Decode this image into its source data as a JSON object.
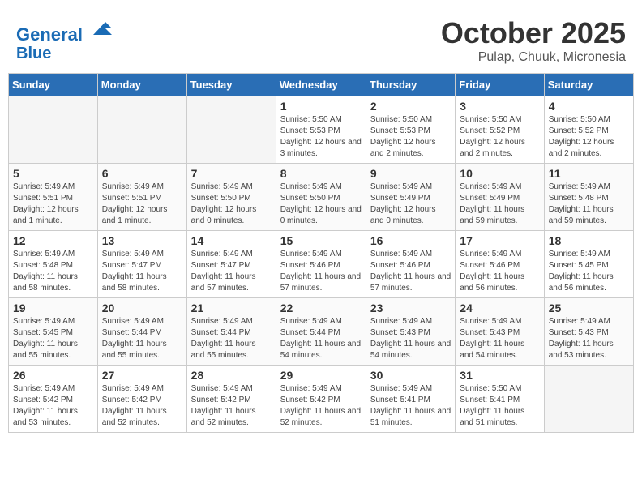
{
  "header": {
    "logo_line1": "General",
    "logo_line2": "Blue",
    "month": "October 2025",
    "location": "Pulap, Chuuk, Micronesia"
  },
  "days_of_week": [
    "Sunday",
    "Monday",
    "Tuesday",
    "Wednesday",
    "Thursday",
    "Friday",
    "Saturday"
  ],
  "weeks": [
    [
      {
        "num": "",
        "info": ""
      },
      {
        "num": "",
        "info": ""
      },
      {
        "num": "",
        "info": ""
      },
      {
        "num": "1",
        "info": "Sunrise: 5:50 AM\nSunset: 5:53 PM\nDaylight: 12 hours and 3 minutes."
      },
      {
        "num": "2",
        "info": "Sunrise: 5:50 AM\nSunset: 5:53 PM\nDaylight: 12 hours and 2 minutes."
      },
      {
        "num": "3",
        "info": "Sunrise: 5:50 AM\nSunset: 5:52 PM\nDaylight: 12 hours and 2 minutes."
      },
      {
        "num": "4",
        "info": "Sunrise: 5:50 AM\nSunset: 5:52 PM\nDaylight: 12 hours and 2 minutes."
      }
    ],
    [
      {
        "num": "5",
        "info": "Sunrise: 5:49 AM\nSunset: 5:51 PM\nDaylight: 12 hours and 1 minute."
      },
      {
        "num": "6",
        "info": "Sunrise: 5:49 AM\nSunset: 5:51 PM\nDaylight: 12 hours and 1 minute."
      },
      {
        "num": "7",
        "info": "Sunrise: 5:49 AM\nSunset: 5:50 PM\nDaylight: 12 hours and 0 minutes."
      },
      {
        "num": "8",
        "info": "Sunrise: 5:49 AM\nSunset: 5:50 PM\nDaylight: 12 hours and 0 minutes."
      },
      {
        "num": "9",
        "info": "Sunrise: 5:49 AM\nSunset: 5:49 PM\nDaylight: 12 hours and 0 minutes."
      },
      {
        "num": "10",
        "info": "Sunrise: 5:49 AM\nSunset: 5:49 PM\nDaylight: 11 hours and 59 minutes."
      },
      {
        "num": "11",
        "info": "Sunrise: 5:49 AM\nSunset: 5:48 PM\nDaylight: 11 hours and 59 minutes."
      }
    ],
    [
      {
        "num": "12",
        "info": "Sunrise: 5:49 AM\nSunset: 5:48 PM\nDaylight: 11 hours and 58 minutes."
      },
      {
        "num": "13",
        "info": "Sunrise: 5:49 AM\nSunset: 5:47 PM\nDaylight: 11 hours and 58 minutes."
      },
      {
        "num": "14",
        "info": "Sunrise: 5:49 AM\nSunset: 5:47 PM\nDaylight: 11 hours and 57 minutes."
      },
      {
        "num": "15",
        "info": "Sunrise: 5:49 AM\nSunset: 5:46 PM\nDaylight: 11 hours and 57 minutes."
      },
      {
        "num": "16",
        "info": "Sunrise: 5:49 AM\nSunset: 5:46 PM\nDaylight: 11 hours and 57 minutes."
      },
      {
        "num": "17",
        "info": "Sunrise: 5:49 AM\nSunset: 5:46 PM\nDaylight: 11 hours and 56 minutes."
      },
      {
        "num": "18",
        "info": "Sunrise: 5:49 AM\nSunset: 5:45 PM\nDaylight: 11 hours and 56 minutes."
      }
    ],
    [
      {
        "num": "19",
        "info": "Sunrise: 5:49 AM\nSunset: 5:45 PM\nDaylight: 11 hours and 55 minutes."
      },
      {
        "num": "20",
        "info": "Sunrise: 5:49 AM\nSunset: 5:44 PM\nDaylight: 11 hours and 55 minutes."
      },
      {
        "num": "21",
        "info": "Sunrise: 5:49 AM\nSunset: 5:44 PM\nDaylight: 11 hours and 55 minutes."
      },
      {
        "num": "22",
        "info": "Sunrise: 5:49 AM\nSunset: 5:44 PM\nDaylight: 11 hours and 54 minutes."
      },
      {
        "num": "23",
        "info": "Sunrise: 5:49 AM\nSunset: 5:43 PM\nDaylight: 11 hours and 54 minutes."
      },
      {
        "num": "24",
        "info": "Sunrise: 5:49 AM\nSunset: 5:43 PM\nDaylight: 11 hours and 54 minutes."
      },
      {
        "num": "25",
        "info": "Sunrise: 5:49 AM\nSunset: 5:43 PM\nDaylight: 11 hours and 53 minutes."
      }
    ],
    [
      {
        "num": "26",
        "info": "Sunrise: 5:49 AM\nSunset: 5:42 PM\nDaylight: 11 hours and 53 minutes."
      },
      {
        "num": "27",
        "info": "Sunrise: 5:49 AM\nSunset: 5:42 PM\nDaylight: 11 hours and 52 minutes."
      },
      {
        "num": "28",
        "info": "Sunrise: 5:49 AM\nSunset: 5:42 PM\nDaylight: 11 hours and 52 minutes."
      },
      {
        "num": "29",
        "info": "Sunrise: 5:49 AM\nSunset: 5:42 PM\nDaylight: 11 hours and 52 minutes."
      },
      {
        "num": "30",
        "info": "Sunrise: 5:49 AM\nSunset: 5:41 PM\nDaylight: 11 hours and 51 minutes."
      },
      {
        "num": "31",
        "info": "Sunrise: 5:50 AM\nSunset: 5:41 PM\nDaylight: 11 hours and 51 minutes."
      },
      {
        "num": "",
        "info": ""
      }
    ]
  ]
}
